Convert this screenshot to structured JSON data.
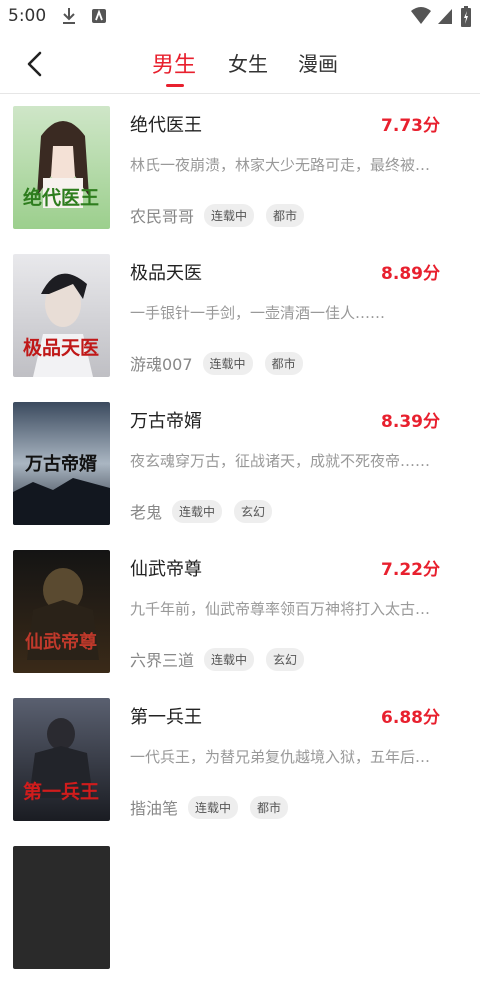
{
  "status_bar": {
    "time": "5:00"
  },
  "header": {
    "tabs": [
      {
        "label": "男生",
        "active": true
      },
      {
        "label": "女生",
        "active": false
      },
      {
        "label": "漫画",
        "active": false
      }
    ]
  },
  "colors": {
    "accent": "#e8202e"
  },
  "books": [
    {
      "title": "绝代医王",
      "score": "7.73分",
      "desc": "林氏一夜崩溃，林家大少无路可走，最终被迫入赘苏家……",
      "author": "农民哥哥",
      "status": "连载中",
      "genre": "都市",
      "cover_text": "绝代医王"
    },
    {
      "title": "极品天医",
      "score": "8.89分",
      "desc": "一手银针一手剑，一壶清酒一佳人……",
      "author": "游魂007",
      "status": "连载中",
      "genre": "都市",
      "cover_text": "极品天医"
    },
    {
      "title": "万古帝婿",
      "score": "8.39分",
      "desc": "夜玄魂穿万古，征战诸天，成就不死夜帝……",
      "author": "老鬼",
      "status": "连载中",
      "genre": "玄幻",
      "cover_text": "万古帝婿"
    },
    {
      "title": "仙武帝尊",
      "score": "7.22分",
      "desc": "九千年前，仙武帝尊率领百万神将打入太古洪荒……",
      "author": "六界三道",
      "status": "连载中",
      "genre": "玄幻",
      "cover_text": "仙武帝尊"
    },
    {
      "title": "第一兵王",
      "score": "6.88分",
      "desc": "一代兵王，为替兄弟复仇越境入狱，五年后归来……",
      "author": "揩油笔",
      "status": "连载中",
      "genre": "都市",
      "cover_text": "第一兵王"
    }
  ]
}
